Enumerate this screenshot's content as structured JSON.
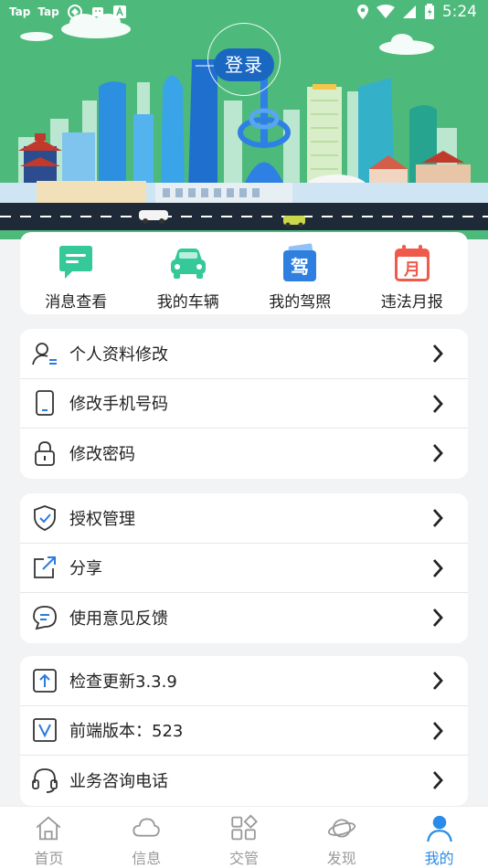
{
  "status_bar": {
    "left_items": [
      "Tap",
      "Tap"
    ],
    "time": "5:24"
  },
  "banner": {
    "login_label": "登录"
  },
  "quick_actions": [
    {
      "label": "消息查看",
      "icon": "message-icon",
      "color": "#35c99a"
    },
    {
      "label": "我的车辆",
      "icon": "car-icon",
      "color": "#35c99a"
    },
    {
      "label": "我的驾照",
      "icon": "license-icon",
      "glyph": "驾",
      "color": "#2f7fe0"
    },
    {
      "label": "违法月报",
      "icon": "calendar-icon",
      "glyph": "月",
      "color": "#f05a4a"
    }
  ],
  "groups": [
    [
      {
        "label": "个人资料修改",
        "icon": "profile-icon"
      },
      {
        "label": "修改手机号码",
        "icon": "phone-icon"
      },
      {
        "label": "修改密码",
        "icon": "lock-icon"
      }
    ],
    [
      {
        "label": "授权管理",
        "icon": "shield-icon"
      },
      {
        "label": "分享",
        "icon": "share-icon"
      },
      {
        "label": "使用意见反馈",
        "icon": "feedback-icon"
      }
    ],
    [
      {
        "label": "检查更新3.3.9",
        "icon": "update-icon"
      },
      {
        "label": "前端版本：523",
        "icon": "version-icon"
      },
      {
        "label": "业务咨询电话",
        "icon": "headset-icon"
      }
    ]
  ],
  "tab_bar": {
    "items": [
      {
        "label": "首页",
        "icon": "home-icon",
        "active": false
      },
      {
        "label": "信息",
        "icon": "cloud-icon",
        "active": false
      },
      {
        "label": "交管",
        "icon": "grid-icon",
        "active": false
      },
      {
        "label": "发现",
        "icon": "planet-icon",
        "active": false
      },
      {
        "label": "我的",
        "icon": "user-icon",
        "active": true
      }
    ],
    "active_color": "#2a8ce8",
    "inactive_color": "#999999"
  }
}
